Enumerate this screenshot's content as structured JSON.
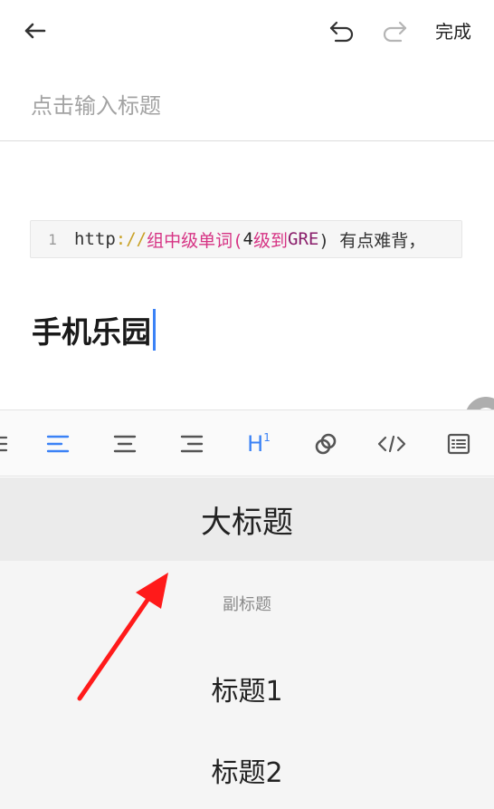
{
  "topbar": {
    "back_icon": "arrow-left-icon",
    "undo_icon": "undo-icon",
    "redo_icon": "redo-icon",
    "done_label": "完成"
  },
  "editor": {
    "title_placeholder": "点击输入标题",
    "code_block": {
      "line_number": "1",
      "protocol": "http",
      "slashes": "://",
      "text_red_1": "组中级单词(",
      "text_num": "4",
      "text_red_2": "级到",
      "text_purple": "GRE",
      "text_rest": ") 有点难背，"
    },
    "heading_text": "手机乐园"
  },
  "toolbar": {
    "items": [
      {
        "icon": "list-icon"
      },
      {
        "icon": "align-left-icon",
        "active": true
      },
      {
        "icon": "align-center-icon"
      },
      {
        "icon": "align-right-icon"
      },
      {
        "icon": "heading-icon",
        "label": "H",
        "sup": "1",
        "active": true
      },
      {
        "icon": "link-icon"
      },
      {
        "icon": "code-icon"
      },
      {
        "icon": "quote-block-icon"
      }
    ],
    "active_color": "#3b82f6",
    "icon_color": "#555555"
  },
  "heading_menu": {
    "items": [
      {
        "label": "大标题",
        "selected": true
      },
      {
        "label": "副标题"
      },
      {
        "label": "标题1"
      },
      {
        "label": "标题2"
      }
    ]
  },
  "annotation": {
    "color": "#ff1a1a"
  }
}
